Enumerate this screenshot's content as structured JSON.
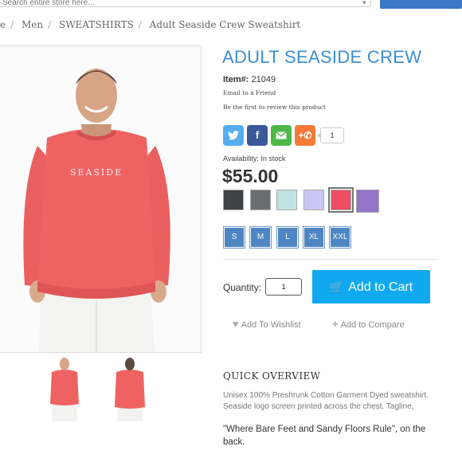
{
  "search": {
    "placeholder": "Search entire store here..."
  },
  "breadcrumb": [
    "e",
    "Men",
    "SWEATSHIRTS",
    "Adult Seaside Crew Sweatshirt"
  ],
  "product": {
    "title": "ADULT SEASIDE CREW",
    "item_label": "Item#:",
    "item_number": "21049",
    "email_friend": "Email to a Friend",
    "review": "Be the first to review this product",
    "availability": "Availability: In stock",
    "price": "$55.00",
    "shirt_text": "SEASIDE"
  },
  "share": {
    "count": "1"
  },
  "colors": [
    "#3e4448",
    "#6b6d6f",
    "#bfe3e2",
    "#c9c8f3",
    "#ec4d65",
    "#9175c7"
  ],
  "selected_color_index": 4,
  "sizes": [
    "S",
    "M",
    "L",
    "XL",
    "XXL"
  ],
  "cart": {
    "quantity_label": "Quantity:",
    "quantity_value": "1",
    "button": "Add to Cart"
  },
  "links": {
    "wishlist": "Add To Wishlist",
    "compare": "Add to Compare"
  },
  "overview": {
    "title": "QUICK OVERVIEW",
    "text": "Unisex 100% Preshrunk Cotton Garment Dyed sweatshirt. Seaside logo screen printed across the chest. Tagline,",
    "quote": "\"Where Bare Feet and Sandy Floors Rule\", on the back."
  }
}
